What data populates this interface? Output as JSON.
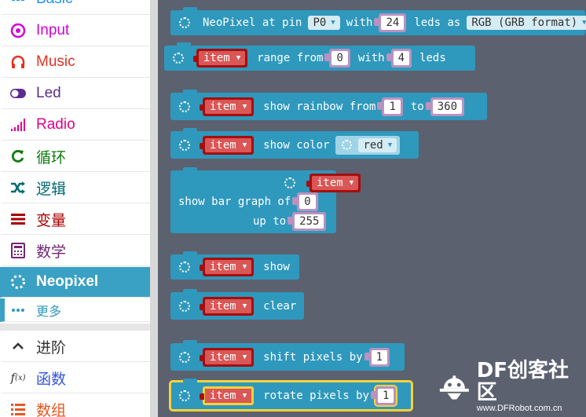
{
  "sidebar": {
    "items": [
      {
        "label": "Basic",
        "color": "#1e90ff",
        "icon": "grid-icon"
      },
      {
        "label": "Input",
        "color": "#d400d4",
        "icon": "target-icon"
      },
      {
        "label": "Music",
        "color": "#e63022",
        "icon": "headphones-icon"
      },
      {
        "label": "Led",
        "color": "#5c2d91",
        "icon": "toggle-icon"
      },
      {
        "label": "Radio",
        "color": "#e3008c",
        "icon": "signal-icon"
      },
      {
        "label": "循环",
        "color": "#107c10",
        "icon": "loop-icon"
      },
      {
        "label": "逻辑",
        "color": "#006970",
        "icon": "shuffle-icon"
      },
      {
        "label": "变量",
        "color": "#a80000",
        "icon": "list-icon"
      },
      {
        "label": "数学",
        "color": "#712672",
        "icon": "calculator-icon"
      },
      {
        "label": "Neopixel",
        "color": "#3aa1c4",
        "icon": "spinner-icon",
        "selected": true
      },
      {
        "label": "更多",
        "color": "#2f98bd",
        "icon": "more-icon"
      },
      {
        "label": "进阶",
        "color": "#333333",
        "icon": "chevron-up-icon"
      },
      {
        "label": "函数",
        "color": "#3455db",
        "icon": "function-icon"
      },
      {
        "label": "数组",
        "color": "#e65722",
        "icon": "array-icon"
      }
    ]
  },
  "blocks": {
    "neopixel": {
      "text": "NeoPixel at pin",
      "pin": "P0",
      "with": "with",
      "leds": "24",
      "leds_as": "leds as",
      "format": "RGB (GRB format)"
    },
    "range": {
      "var": "item",
      "text": "range from",
      "from": "0",
      "with": "with",
      "count": "4",
      "leds": "leds"
    },
    "rainbow": {
      "var": "item",
      "text": "show rainbow from",
      "from": "1",
      "to": "to",
      "end": "360"
    },
    "color": {
      "var": "item",
      "text": "show color",
      "color": "red"
    },
    "bar": {
      "var": "item",
      "text": "show bar graph of",
      "value": "0",
      "up_to": "up to",
      "max": "255"
    },
    "show": {
      "var": "item",
      "text": "show"
    },
    "clear": {
      "var": "item",
      "text": "clear"
    },
    "shift": {
      "var": "item",
      "text": "shift pixels by",
      "value": "1"
    },
    "rotate": {
      "var": "item",
      "text": "rotate pixels by",
      "value": "1"
    }
  },
  "watermark": {
    "title": "DF创客社区",
    "url": "www.DFRobot.com.cn"
  }
}
